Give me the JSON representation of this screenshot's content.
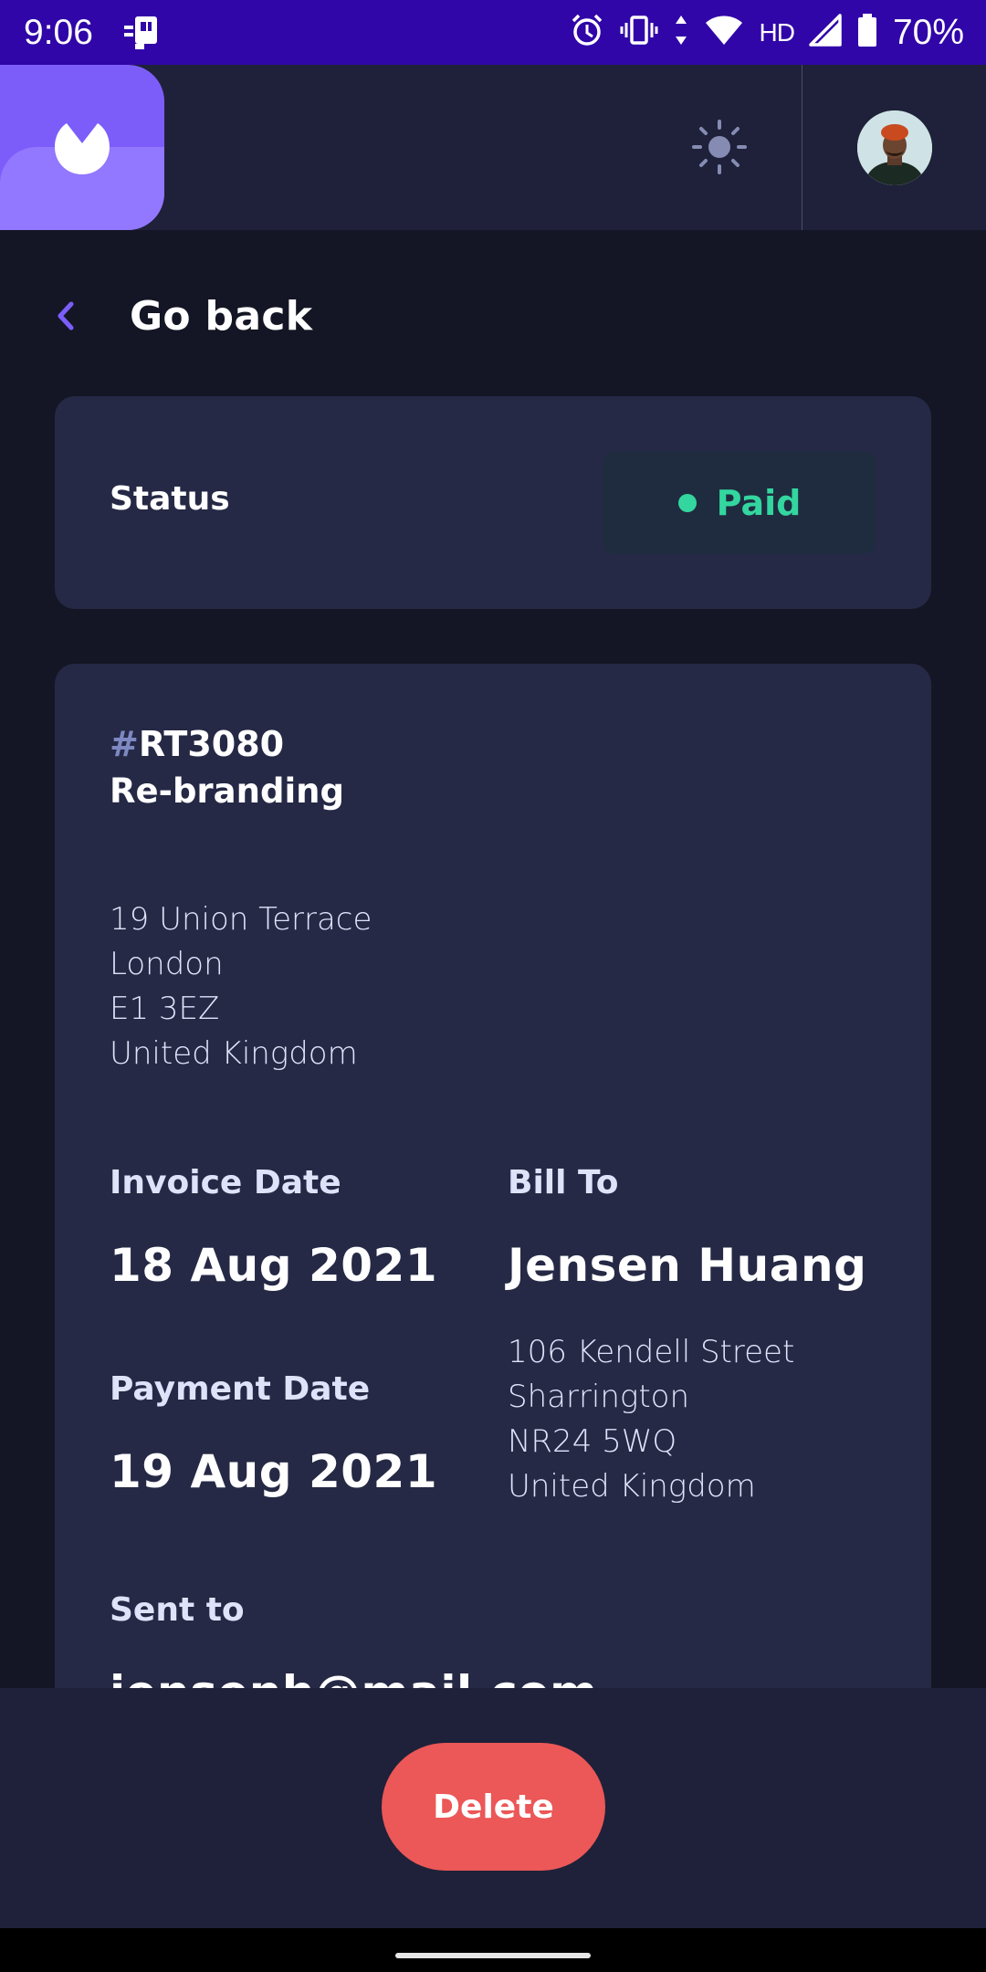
{
  "status_bar": {
    "time": "9:06",
    "network": "HD",
    "battery": "70%",
    "icons": [
      "sim-card-icon",
      "alarm-icon",
      "vibrate-icon",
      "data-arrows-icon",
      "wifi-icon",
      "signal-icon",
      "battery-icon"
    ]
  },
  "header": {
    "logo_icon": "app-logo-icon",
    "theme_icon": "sun-icon",
    "avatar_icon": "user-avatar"
  },
  "nav": {
    "back_label": "Go back",
    "back_icon": "chevron-left-icon"
  },
  "status_card": {
    "label": "Status",
    "badge_text": "Paid",
    "badge_color": "#33d69f"
  },
  "invoice": {
    "id_prefix": "#",
    "id": "RT3080",
    "description": "Re-branding",
    "sender_address": {
      "street": "19 Union Terrace",
      "city": "London",
      "post_code": "E1 3EZ",
      "country": "United Kingdom"
    },
    "invoice_date_label": "Invoice Date",
    "invoice_date": "18 Aug 2021",
    "payment_date_label": "Payment Date",
    "payment_date": "19 Aug 2021",
    "bill_to_label": "Bill To",
    "client_name": "Jensen Huang",
    "client_address": {
      "street": "106 Kendell Street",
      "city": "Sharrington",
      "post_code": "NR24 5WQ",
      "country": "United Kingdom"
    },
    "sent_to_label": "Sent to",
    "sent_to_email": "jensenh@mail.com"
  },
  "actions": {
    "delete_label": "Delete",
    "delete_color": "#ec5757"
  },
  "colors": {
    "accent": "#7c5dfa",
    "background": "#141625",
    "card": "#252945",
    "status_bar": "#3006a8"
  }
}
